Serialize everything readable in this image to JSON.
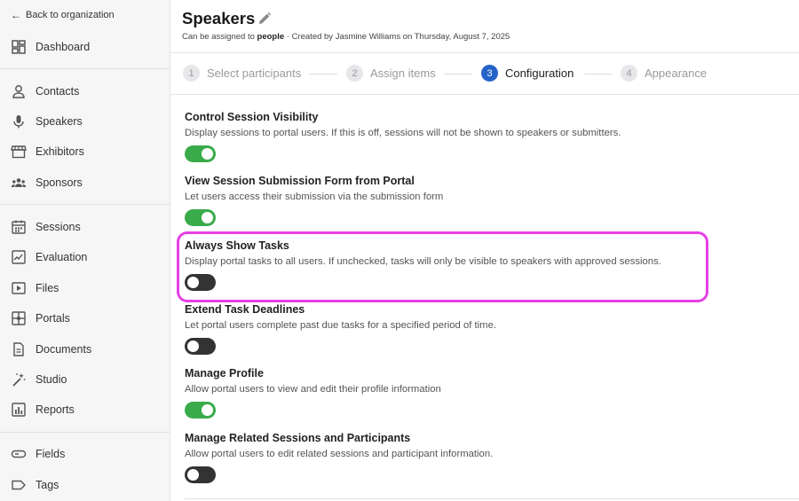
{
  "sidebar": {
    "back_label": "Back to organization",
    "items": [
      {
        "label": "Dashboard",
        "icon": "dashboard-icon"
      },
      {
        "label": "Contacts",
        "icon": "person-icon"
      },
      {
        "label": "Speakers",
        "icon": "microphone-icon"
      },
      {
        "label": "Exhibitors",
        "icon": "storefront-icon"
      },
      {
        "label": "Sponsors",
        "icon": "group-icon"
      },
      {
        "label": "Sessions",
        "icon": "calendar-icon"
      },
      {
        "label": "Evaluation",
        "icon": "chart-edit-icon"
      },
      {
        "label": "Files",
        "icon": "play-file-icon"
      },
      {
        "label": "Portals",
        "icon": "portal-icon"
      },
      {
        "label": "Documents",
        "icon": "document-icon"
      },
      {
        "label": "Studio",
        "icon": "magic-wand-icon"
      },
      {
        "label": "Reports",
        "icon": "bar-chart-icon"
      },
      {
        "label": "Fields",
        "icon": "input-field-icon"
      },
      {
        "label": "Tags",
        "icon": "tag-icon"
      }
    ]
  },
  "header": {
    "title": "Speakers",
    "subtitle_prefix": "Can be assigned to ",
    "subtitle_bold": "people",
    "subtitle_suffix": " · Created by Jasmine Williams on Thursday, August 7, 2025"
  },
  "steps": [
    {
      "number": "1",
      "label": "Select participants",
      "active": false
    },
    {
      "number": "2",
      "label": "Assign items",
      "active": false
    },
    {
      "number": "3",
      "label": "Configuration",
      "active": true
    },
    {
      "number": "4",
      "label": "Appearance",
      "active": false
    }
  ],
  "settings": [
    {
      "title": "Control Session Visibility",
      "description": "Display sessions to portal users. If this is off, sessions will not be shown to speakers or submitters.",
      "enabled": true
    },
    {
      "title": "View Session Submission Form from Portal",
      "description": "Let users access their submission via the submission form",
      "enabled": true
    },
    {
      "title": "Always Show Tasks",
      "description": "Display portal tasks to all users. If unchecked, tasks will only be visible to speakers with approved sessions.",
      "enabled": false
    },
    {
      "title": "Extend Task Deadlines",
      "description": "Let portal users complete past due tasks for a specified period of time.",
      "enabled": false
    },
    {
      "title": "Manage Profile",
      "description": "Allow portal users to view and edit their profile information",
      "enabled": true
    },
    {
      "title": "Manage Related Sessions and Participants",
      "description": "Allow portal users to edit related sessions and participant information.",
      "enabled": false
    }
  ],
  "colors": {
    "accent": "#2563c9",
    "toggle_on": "#3aab4b",
    "toggle_off": "#333333",
    "highlight": "#e640e6"
  }
}
